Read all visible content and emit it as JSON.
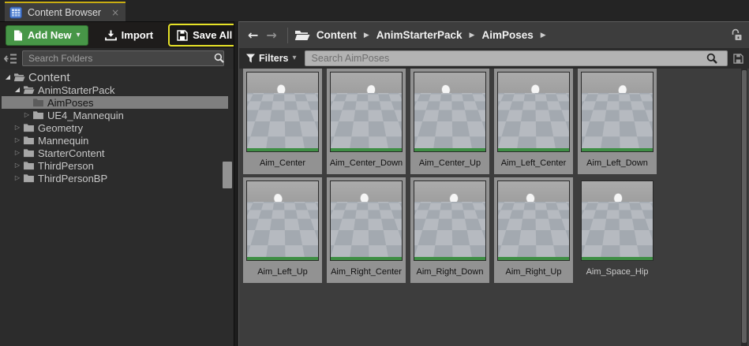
{
  "tab": {
    "title": "Content Browser"
  },
  "toolbar": {
    "add_new": "Add New",
    "import": "Import",
    "save_all": "Save All"
  },
  "breadcrumb": {
    "items": [
      "Content",
      "AnimStarterPack",
      "AimPoses"
    ]
  },
  "folder_search": {
    "placeholder": "Search Folders"
  },
  "asset_search": {
    "placeholder": "Search AimPoses"
  },
  "filters_label": "Filters",
  "icons": {
    "close": "×",
    "caret_down": "▾",
    "crumb_separator": "▶",
    "back_arrow": "←",
    "forward_arrow": "→",
    "expanded_arrow": "◢",
    "collapsed_arrow": "▷"
  },
  "tree": [
    {
      "label": "Content",
      "depth": 0,
      "state": "expanded",
      "folder": "open",
      "selected": false,
      "root": true
    },
    {
      "label": "AnimStarterPack",
      "depth": 1,
      "state": "expanded",
      "folder": "open",
      "selected": false,
      "root": false
    },
    {
      "label": "AimPoses",
      "depth": 2,
      "state": "leaf",
      "folder": "closed",
      "selected": true,
      "root": false
    },
    {
      "label": "UE4_Mannequin",
      "depth": 2,
      "state": "collapsed",
      "folder": "closed",
      "selected": false,
      "root": false
    },
    {
      "label": "Geometry",
      "depth": 1,
      "state": "collapsed",
      "folder": "closed",
      "selected": false,
      "root": false
    },
    {
      "label": "Mannequin",
      "depth": 1,
      "state": "collapsed",
      "folder": "closed",
      "selected": false,
      "root": false
    },
    {
      "label": "StarterContent",
      "depth": 1,
      "state": "collapsed",
      "folder": "closed",
      "selected": false,
      "root": false
    },
    {
      "label": "ThirdPerson",
      "depth": 1,
      "state": "collapsed",
      "folder": "closed",
      "selected": false,
      "root": false
    },
    {
      "label": "ThirdPersonBP",
      "depth": 1,
      "state": "collapsed",
      "folder": "closed",
      "selected": false,
      "root": false
    }
  ],
  "assets": [
    {
      "name": "Aim_Center",
      "selected": true
    },
    {
      "name": "Aim_Center_Down",
      "selected": true
    },
    {
      "name": "Aim_Center_Up",
      "selected": true
    },
    {
      "name": "Aim_Left_Center",
      "selected": true
    },
    {
      "name": "Aim_Left_Down",
      "selected": true
    },
    {
      "name": "Aim_Left_Up",
      "selected": true
    },
    {
      "name": "Aim_Right_Center",
      "selected": true
    },
    {
      "name": "Aim_Right_Down",
      "selected": true
    },
    {
      "name": "Aim_Right_Up",
      "selected": true
    },
    {
      "name": "Aim_Space_Hip",
      "selected": false
    }
  ],
  "colors": {
    "tab_accent_yellow": "#c9ad12",
    "add_new_green": "#479647",
    "save_all_outline_yellow": "#e5e127",
    "selection_gray": "#929292",
    "anim_strip_green": "#3e8e44",
    "breadcrumb_bg": "#3d3d3d",
    "panel_bg": "#2c2c2c"
  }
}
